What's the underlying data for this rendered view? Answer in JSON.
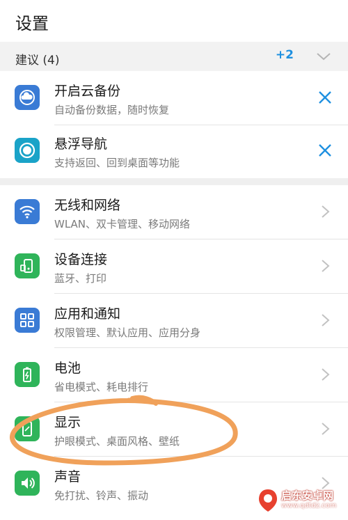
{
  "header": {
    "title": "设置"
  },
  "suggestions": {
    "title": "建议 (4)",
    "more": "+2",
    "items": [
      {
        "title": "开启云备份",
        "subtitle": "自动备份数据，随时恢复",
        "icon": "cloud-backup-icon",
        "color": "#3a7bd5"
      },
      {
        "title": "悬浮导航",
        "subtitle": "支持返回、回到桌面等功能",
        "icon": "floating-dock-icon",
        "color": "#1aa3c8"
      }
    ]
  },
  "settings": {
    "items": [
      {
        "title": "无线和网络",
        "subtitle": "WLAN、双卡管理、移动网络",
        "icon": "wifi-icon",
        "color": "#3a7bd5"
      },
      {
        "title": "设备连接",
        "subtitle": "蓝牙、打印",
        "icon": "device-connect-icon",
        "color": "#2fb45a"
      },
      {
        "title": "应用和通知",
        "subtitle": "权限管理、默认应用、应用分身",
        "icon": "apps-grid-icon",
        "color": "#3a7bd5"
      },
      {
        "title": "电池",
        "subtitle": "省电模式、耗电排行",
        "icon": "battery-icon",
        "color": "#2fb45a"
      },
      {
        "title": "显示",
        "subtitle": "护眼模式、桌面风格、壁纸",
        "icon": "display-icon",
        "color": "#2fb45a"
      },
      {
        "title": "声音",
        "subtitle": "免打扰、铃声、振动",
        "icon": "sound-icon",
        "color": "#2fb45a"
      }
    ]
  },
  "watermark": {
    "line1": "启东安卓网",
    "line2": "www.qdtdz.com"
  },
  "colors": {
    "accent": "#1e90e0",
    "annotation": "#f0a15a"
  }
}
